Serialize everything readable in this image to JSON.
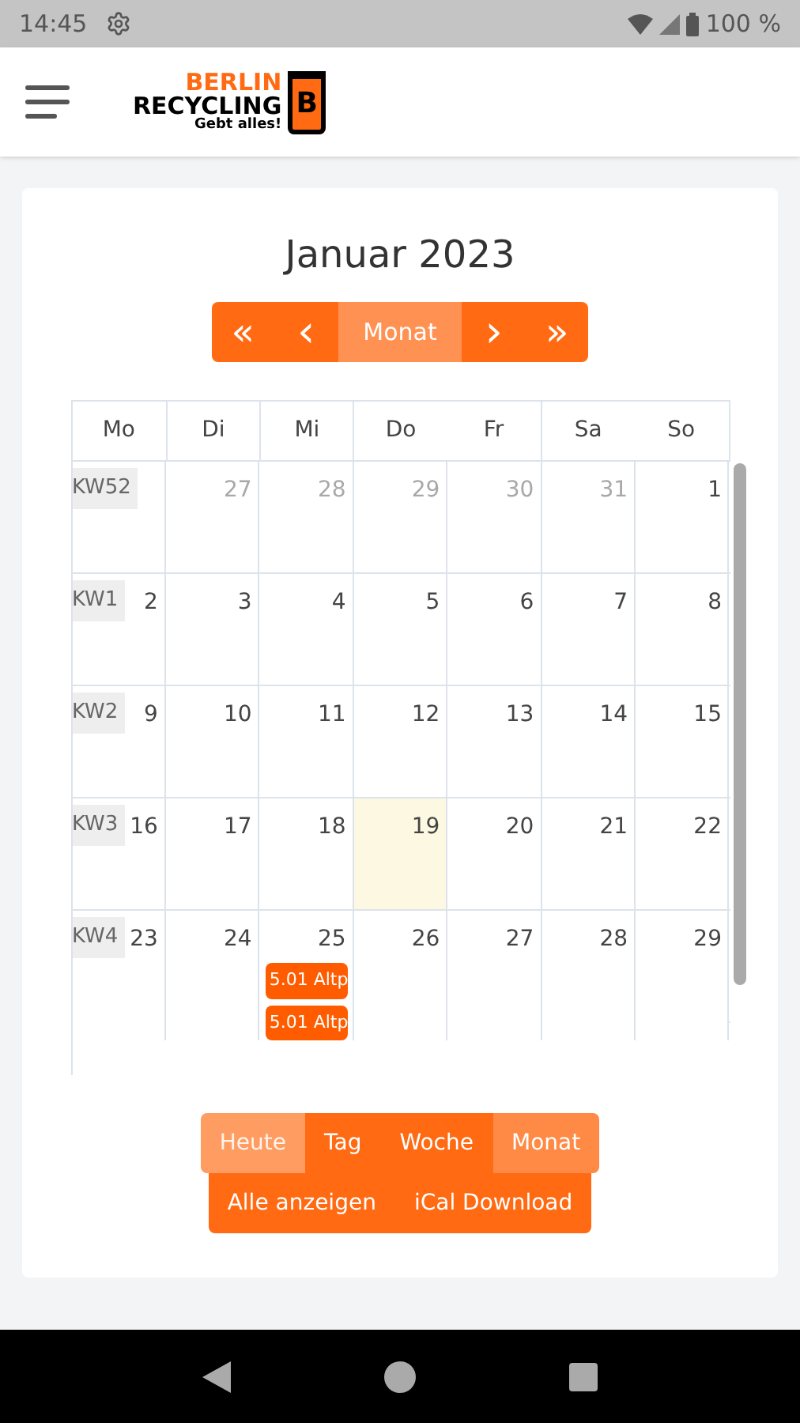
{
  "status_bar": {
    "time": "14:45",
    "battery": "100 %"
  },
  "logo": {
    "line1": "BERLIN",
    "line2": "RECYCLING",
    "tagline": "Gebt alles!",
    "mark": "B"
  },
  "calendar": {
    "title": "Januar 2023",
    "nav": [
      {
        "label": "«",
        "kind": "first"
      },
      {
        "label": "‹",
        "kind": "prev"
      },
      {
        "label": "Monat",
        "kind": "current"
      },
      {
        "label": "›",
        "kind": "next"
      },
      {
        "label": "»",
        "kind": "last"
      }
    ],
    "weekdays": [
      "Mo",
      "Di",
      "Mi",
      "Do",
      "Fr",
      "Sa",
      "So"
    ],
    "weeks": [
      {
        "label": "KW52",
        "days": [
          {
            "today": false
          },
          {
            "day": "27",
            "muted": true,
            "today": false
          },
          {
            "day": "28",
            "muted": true,
            "today": false
          },
          {
            "day": "29",
            "muted": true,
            "today": false
          },
          {
            "day": "30",
            "muted": true,
            "today": false
          },
          {
            "day": "31",
            "muted": true,
            "today": false
          },
          {
            "day": "1",
            "muted": false,
            "today": false
          }
        ]
      },
      {
        "label": "KW1",
        "days": [
          {
            "day": "2",
            "muted": false,
            "today": false
          },
          {
            "day": "3",
            "muted": false,
            "today": false
          },
          {
            "day": "4",
            "muted": false,
            "today": false
          },
          {
            "day": "5",
            "muted": false,
            "today": false
          },
          {
            "day": "6",
            "muted": false,
            "today": false
          },
          {
            "day": "7",
            "muted": false,
            "today": false
          },
          {
            "day": "8",
            "muted": false,
            "today": false
          }
        ]
      },
      {
        "label": "KW2",
        "days": [
          {
            "day": "9",
            "muted": false,
            "today": false
          },
          {
            "day": "10",
            "muted": false,
            "today": false
          },
          {
            "day": "11",
            "muted": false,
            "today": false
          },
          {
            "day": "12",
            "muted": false,
            "today": false
          },
          {
            "day": "13",
            "muted": false,
            "today": false
          },
          {
            "day": "14",
            "muted": false,
            "today": false
          },
          {
            "day": "15",
            "muted": false,
            "today": false
          }
        ]
      },
      {
        "label": "KW3",
        "days": [
          {
            "day": "16",
            "muted": false,
            "today": false
          },
          {
            "day": "17",
            "muted": false,
            "today": false
          },
          {
            "day": "18",
            "muted": false,
            "today": false
          },
          {
            "day": "19",
            "muted": false,
            "today": true
          },
          {
            "day": "20",
            "muted": false,
            "today": false
          },
          {
            "day": "21",
            "muted": false,
            "today": false
          },
          {
            "day": "22",
            "muted": false,
            "today": false
          }
        ]
      },
      {
        "label": "KW4",
        "days": [
          {
            "day": "23",
            "muted": false,
            "today": false
          },
          {
            "day": "24",
            "muted": false,
            "today": false
          },
          {
            "day": "25",
            "muted": false,
            "today": false,
            "events": [
              "5.01 Altp",
              "5.01 Altp"
            ]
          },
          {
            "day": "26",
            "muted": false,
            "today": false
          },
          {
            "day": "27",
            "muted": false,
            "today": false
          },
          {
            "day": "28",
            "muted": false,
            "today": false
          },
          {
            "day": "29",
            "muted": false,
            "today": false
          }
        ]
      }
    ],
    "views": [
      {
        "label": "Heute",
        "selected": false,
        "disabled": true
      },
      {
        "label": "Tag",
        "selected": false,
        "disabled": false
      },
      {
        "label": "Woche",
        "selected": false,
        "disabled": false
      },
      {
        "label": "Monat",
        "selected": true,
        "disabled": false
      }
    ],
    "actions": [
      "Alle anzeigen",
      "iCal Download"
    ]
  }
}
